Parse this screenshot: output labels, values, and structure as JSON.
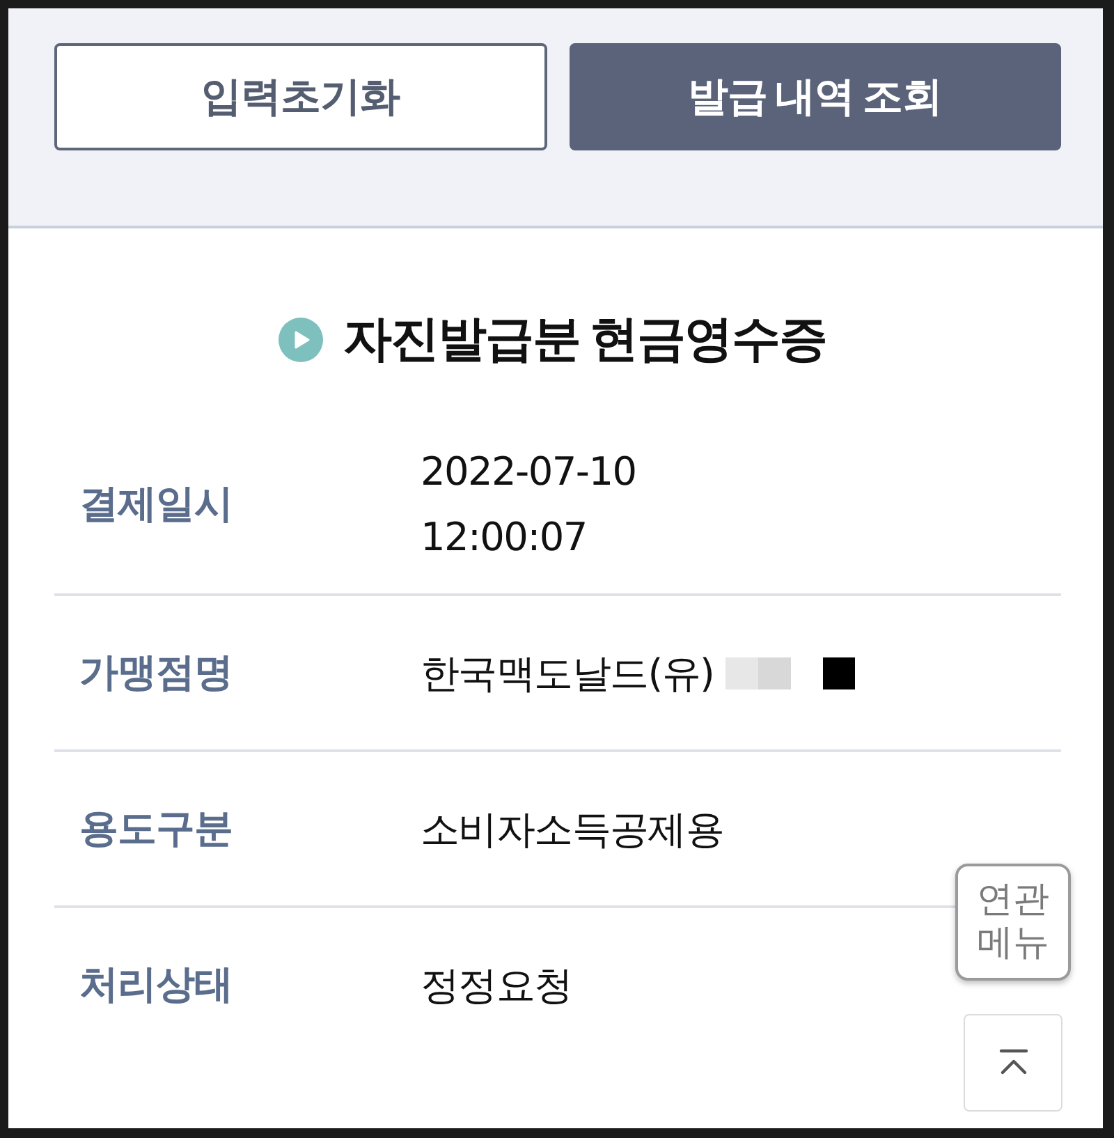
{
  "actions": [
    {
      "label": "입력초기화",
      "kind": "outline"
    },
    {
      "label": "발급 내역 조회",
      "kind": "filled"
    }
  ],
  "section": {
    "title": "자진발급분 현금영수증"
  },
  "details": [
    {
      "label": "결제일시",
      "value_lines": [
        "2022-07-10",
        "12:00:07"
      ],
      "redacted": false
    },
    {
      "label": "가맹점명",
      "value_lines": [
        "한국맥도날드(유)"
      ],
      "redacted": true
    },
    {
      "label": "용도구분",
      "value_lines": [
        "소비자소득공제용"
      ],
      "redacted": false
    },
    {
      "label": "처리상태",
      "value_lines": [
        "정정요청"
      ],
      "redacted": false
    }
  ],
  "floating": {
    "related_menu": "연관 메뉴"
  }
}
